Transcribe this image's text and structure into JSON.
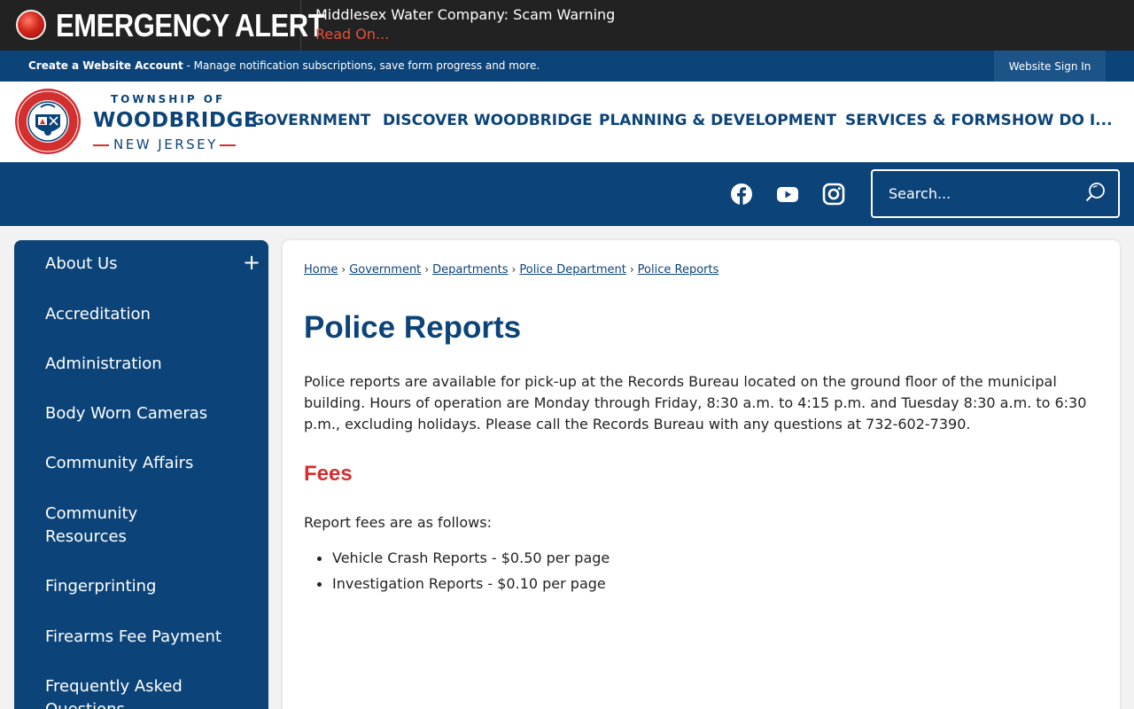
{
  "emergency": {
    "title": "EMERGENCY ALERT",
    "message": "Middlesex Water Company: Scam Warning",
    "link": "Read On..."
  },
  "account": {
    "create_label": "Create a Website Account",
    "description": " - Manage notification subscriptions, save form progress and more.",
    "signin_label": "Website Sign In"
  },
  "logo": {
    "top": "TOWNSHIP OF",
    "main": "WOODBRIDGE",
    "sub": "NEW JERSEY"
  },
  "nav": [
    {
      "label": "GOVERNMENT"
    },
    {
      "label": "DISCOVER WOODBRIDGE"
    },
    {
      "label": "PLANNING & DEVELOPMENT"
    },
    {
      "label": "SERVICES & FORMS"
    },
    {
      "label": "HOW DO I..."
    }
  ],
  "social": [
    "facebook-icon",
    "youtube-icon",
    "instagram-icon"
  ],
  "search": {
    "placeholder": "Search..."
  },
  "sidebar": {
    "expand_symbol": "+",
    "items": [
      {
        "label": "About Us"
      },
      {
        "label": "Accreditation"
      },
      {
        "label": "Administration"
      },
      {
        "label": "Body Worn Cameras"
      },
      {
        "label": "Community Affairs"
      },
      {
        "label": "Community Resources"
      },
      {
        "label": "Fingerprinting"
      },
      {
        "label": "Firearms Fee Payment"
      },
      {
        "label": "Frequently Asked Questions"
      }
    ]
  },
  "breadcrumb": [
    "Home",
    "Government",
    "Departments",
    "Police Department",
    "Police Reports"
  ],
  "page": {
    "title": "Police Reports",
    "body": "Police reports are available for pick-up at the Records Bureau located on the ground floor of the municipal building. Hours of operation are Monday through Friday, 8:30 a.m. to 4:15 p.m. and Tuesday 8:30 a.m. to 6:30 p.m., excluding holidays. Please call the Records Bureau with any questions at 732-602-7390.",
    "fees_heading": "Fees",
    "fees_intro": "Report fees are as follows:",
    "fees": [
      "Vehicle Crash Reports - $0.50 per page",
      "Investigation Reports - $0.10 per page"
    ]
  },
  "colors": {
    "brand_blue": "#0c4479",
    "alert_red": "#d32f2f",
    "alert_bar": "#222222"
  }
}
